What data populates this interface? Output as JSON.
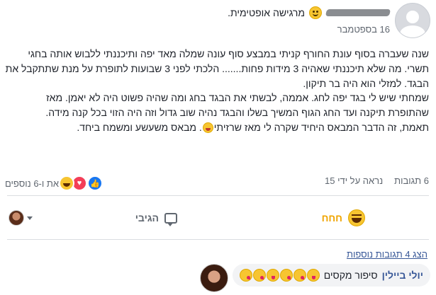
{
  "post": {
    "feeling_text": "מרגישה אופטימית.",
    "date": "16 בספטמבר",
    "body_lines": [
      "שנה שעברה בסוף עונת החורף קניתי במבצע סוף עונה שמלה מאד יפה ותיכננתי ללבוש אותה בחגי תשרי. מה שלא תיכננתי שאהיה 3 מידות פחות....... הלכתי לפני 3 שבועות לתופרת על מנת שתתקבל את הבגד. למזלי הוא היה בר תיקון.",
      "שמחתי שיש לי בגד יפה לחג. אממה, לבשתי את הבגד בחג ומה שהיה פשוט היה לא יאמן. מאז שהתופרת תיקנה ועד החג הגוף המשיך בשלו והבגד נהיה שוב גדול וזה היה הזוי בכל קנה מידה.",
      "תאמת, זה הדבר המבאס היחיד שקרה לי מאז שרזיתי",
      ". מבאס משעשע ומשמח ביחד."
    ]
  },
  "stats": {
    "reactions_text": "את ו-6 נוספים",
    "comments_count": "6 תגובות",
    "seen_by": "נראה על ידי 15"
  },
  "actions": {
    "haha_label": "חחח",
    "comment_label": "הגיבי"
  },
  "comments": {
    "show_more": "הצג 4 תגובות נוספות",
    "first": {
      "author": "יולי ביילין",
      "text": "סיפור מקסים"
    }
  },
  "icons": {
    "feeling": "smiling-face-icon",
    "reactions": [
      "like-icon",
      "love-icon",
      "haha-icon"
    ],
    "comment": "comment-icon",
    "audience_caret": "chevron-down-icon"
  },
  "colors": {
    "link": "#385898",
    "haha": "#f0a500",
    "like": "#1877f2",
    "love": "#f33e58",
    "muted": "#606770"
  }
}
